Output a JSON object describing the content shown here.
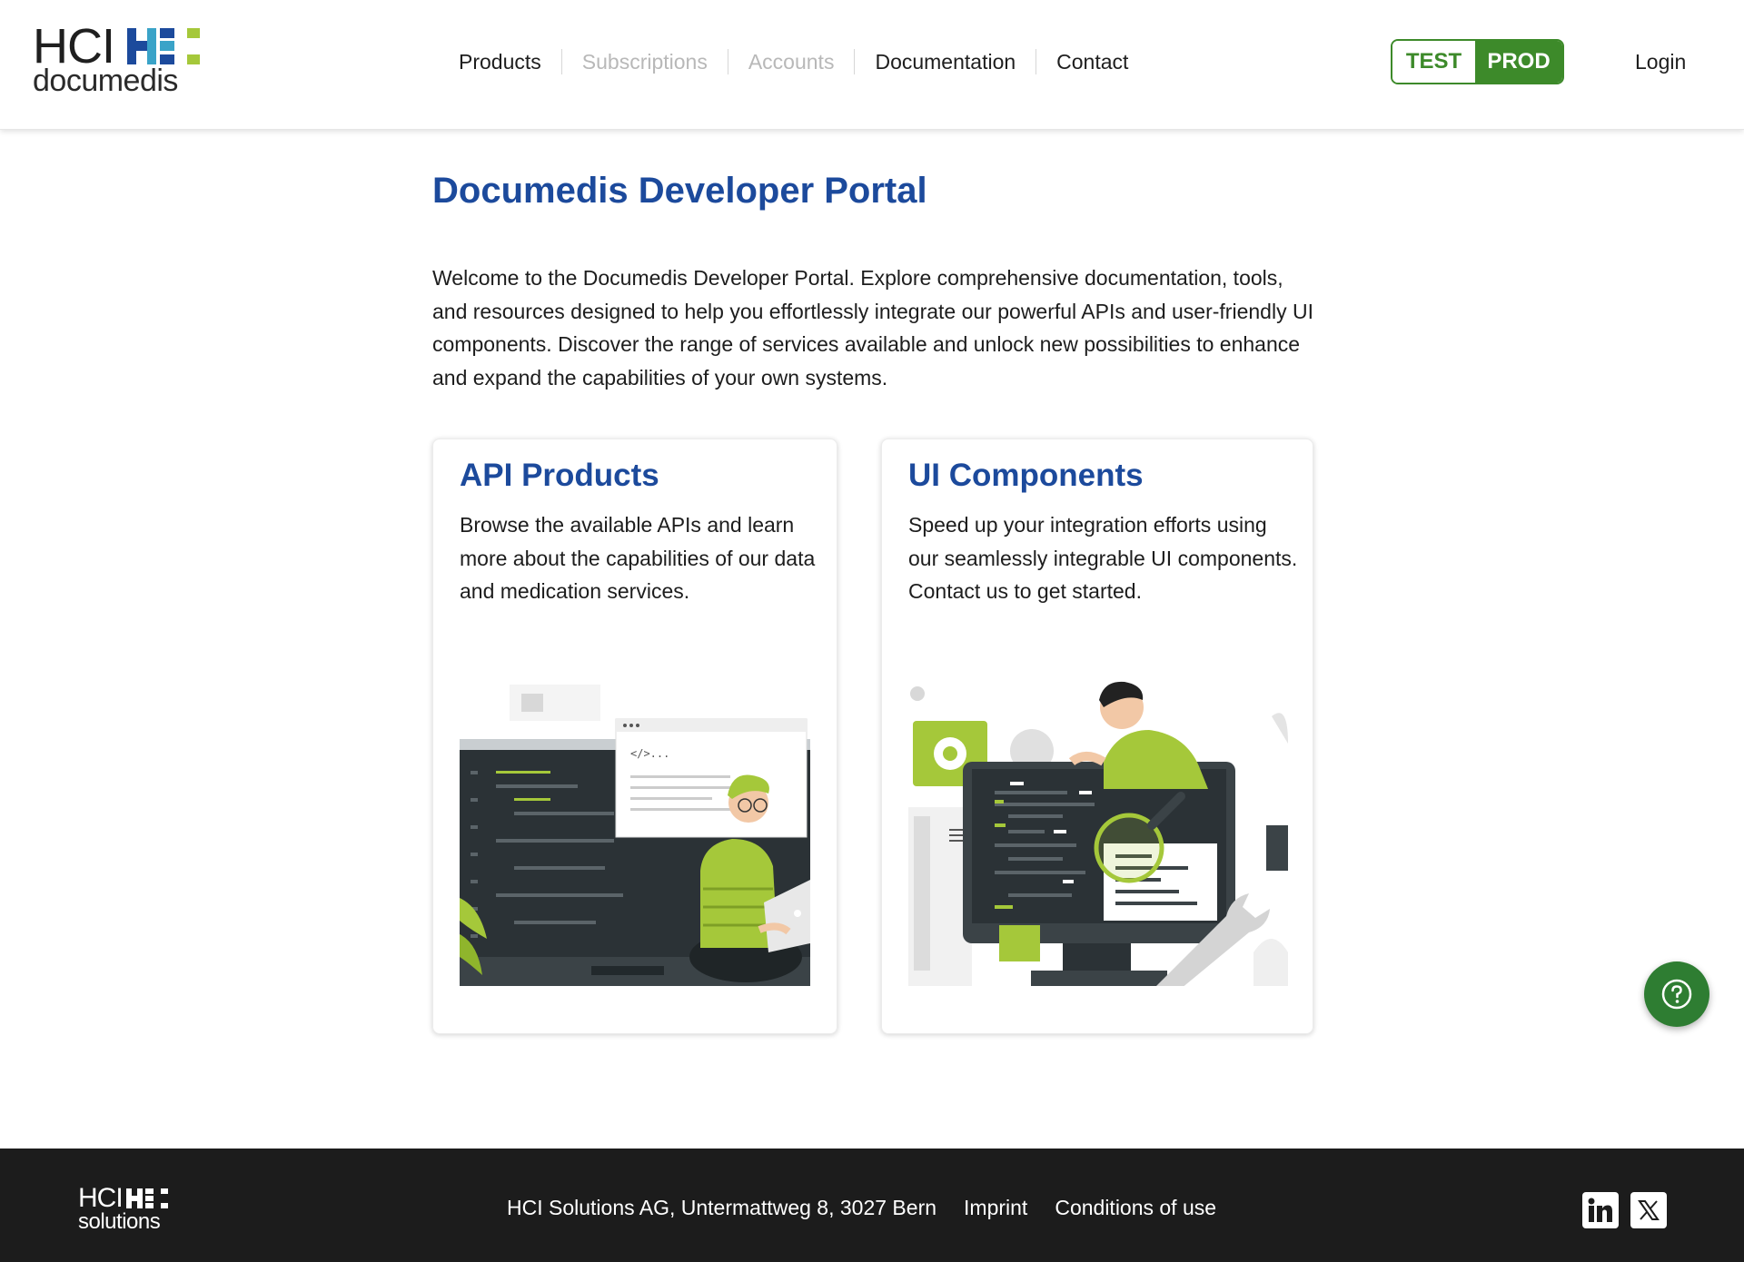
{
  "header": {
    "logo": {
      "brand": "HCI",
      "product": "documedis"
    },
    "nav": [
      {
        "label": "Products",
        "enabled": true
      },
      {
        "label": "Subscriptions",
        "enabled": false
      },
      {
        "label": "Accounts",
        "enabled": false
      },
      {
        "label": "Documentation",
        "enabled": true
      },
      {
        "label": "Contact",
        "enabled": true
      }
    ],
    "environment": {
      "test_label": "TEST",
      "prod_label": "PROD",
      "selected": "PROD"
    },
    "login_label": "Login"
  },
  "main": {
    "title": "Documedis Developer Portal",
    "intro": "Welcome to the Documedis Developer Portal. Explore comprehensive documentation, tools, and resources designed to help you effortlessly integrate our powerful APIs and user-friendly UI components. Discover the range of services available and unlock new possibilities to enhance and expand the capabilities of your own systems.",
    "cards": [
      {
        "title": "API Products",
        "text": "Browse the available APIs and learn more about the capabilities of our data and medication services.",
        "illustration": "developer-with-laptop-illustration"
      },
      {
        "title": "UI Components",
        "text": "Speed up your integration efforts using our seamlessly integrable UI components. Contact us to get started.",
        "illustration": "developer-with-monitor-illustration"
      }
    ]
  },
  "help": {
    "icon": "question-icon"
  },
  "footer": {
    "logo": {
      "brand": "HCI",
      "sub": "solutions"
    },
    "address": "HCI Solutions AG, Untermattweg 8, 3027 Bern",
    "links": [
      "Imprint",
      "Conditions of use"
    ],
    "social": [
      "linkedin-icon",
      "x-icon"
    ]
  },
  "colors": {
    "brand_blue": "#1c4a9c",
    "brand_green": "#3d8a2a",
    "lime": "#a5c83a",
    "footer_bg": "#1c1c1c"
  }
}
